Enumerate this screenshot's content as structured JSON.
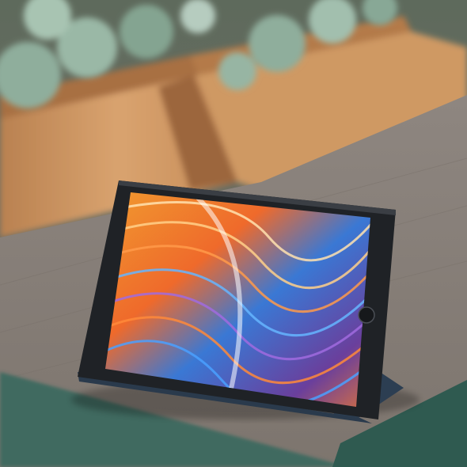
{
  "scene": {
    "subject": "tablet-on-wooden-table",
    "background": "succulent-planter-boxes",
    "colors": {
      "planter_wood": "#c98f5c",
      "planter_wood_dark": "#8a5a34",
      "succulent": "#8fae9c",
      "table_wood": "#8d857d",
      "table_edge": "#3f6b60",
      "tablet_bezel": "#1f2226",
      "case_blue": "#2c3e52",
      "wallpaper_orange": "#f27a2a",
      "wallpaper_blue": "#2f8fe0",
      "wallpaper_purple": "#6a3f9c"
    }
  }
}
